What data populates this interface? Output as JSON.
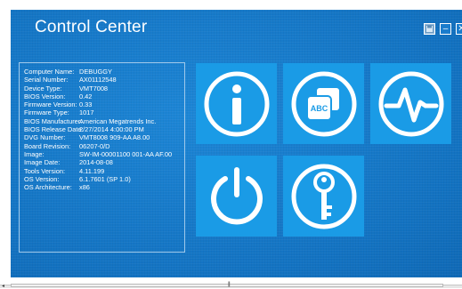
{
  "window": {
    "title": "Control Center",
    "controls": {
      "save_icon": "save-icon",
      "minimize_label": "–",
      "close_label": "✕"
    }
  },
  "system_info": [
    {
      "key": "Computer Name:",
      "value": "DEBUGGY"
    },
    {
      "key": "Serial Number:",
      "value": "AX01112548"
    },
    {
      "key": "Device Type:",
      "value": "VMT7008"
    },
    {
      "key": "BIOS Version:",
      "value": "0.42"
    },
    {
      "key": "Firmware Version:",
      "value": "0.33"
    },
    {
      "key": "Firmware Type:",
      "value": "1017"
    },
    {
      "key": "BIOS Manufacturer:",
      "value": "American Megatrends Inc."
    },
    {
      "key": "BIOS Release Date:",
      "value": "2/27/2014 4:00:00 PM"
    },
    {
      "key": "DVG Number:",
      "value": "VMT8008 909-AA A8.00"
    },
    {
      "key": "Board Revision:",
      "value": "06207-0/D"
    },
    {
      "key": "Image:",
      "value": "SW-IM-00001100 001-AA AF.00"
    },
    {
      "key": "Image Date:",
      "value": "2014-08-08"
    },
    {
      "key": "Tools Version:",
      "value": "4.11.199"
    },
    {
      "key": "OS Version:",
      "value": "6.1.7601 (SP 1.0)"
    },
    {
      "key": "OS Architecture:",
      "value": "x86"
    }
  ],
  "tiles": {
    "info": {
      "icon": "info-icon"
    },
    "abc": {
      "icon": "abc-cards-icon",
      "label": "ABC"
    },
    "monitor": {
      "icon": "heartbeat-icon"
    },
    "power": {
      "icon": "power-icon"
    },
    "security": {
      "icon": "key-icon"
    }
  },
  "scrollbar": {
    "left_arrow": "◂",
    "grip": "|||"
  },
  "colors": {
    "background": "#1677c7",
    "tile": "#1a9be6",
    "text": "#ffffff"
  }
}
